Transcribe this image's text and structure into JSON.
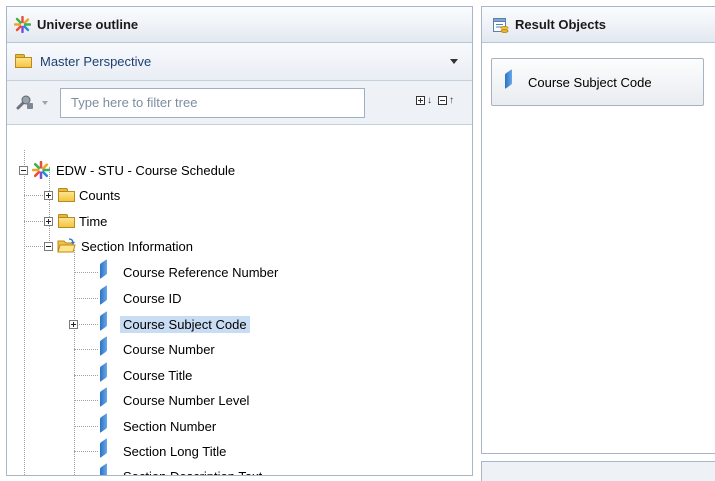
{
  "outline": {
    "title": "Universe outline",
    "perspective": "Master Perspective",
    "filter_placeholder": "Type here to filter tree",
    "tree": {
      "root": "EDW - STU - Course Schedule",
      "folders": [
        "Counts",
        "Time",
        "Section Information"
      ],
      "section_items": [
        "Course Reference Number",
        "Course ID",
        "Course Subject Code",
        "Course Number",
        "Course Title",
        "Course Number Level",
        "Section Number",
        "Section Long Title",
        "Section Description Text"
      ],
      "selected_item": "Course Subject Code"
    }
  },
  "result": {
    "title": "Result Objects",
    "items": [
      "Course Subject Code"
    ]
  },
  "icons": {
    "universe": "universe-star-icon",
    "folder": "folder-icon",
    "dimension": "dimension-object-icon",
    "tool": "tools-icon",
    "result": "result-objects-icon"
  },
  "colors": {
    "selection": "#c8ddf4",
    "perspective_text": "#1d3f72",
    "dimension_blue": "#2b72c4",
    "folder_yellow": "#f2c443"
  }
}
